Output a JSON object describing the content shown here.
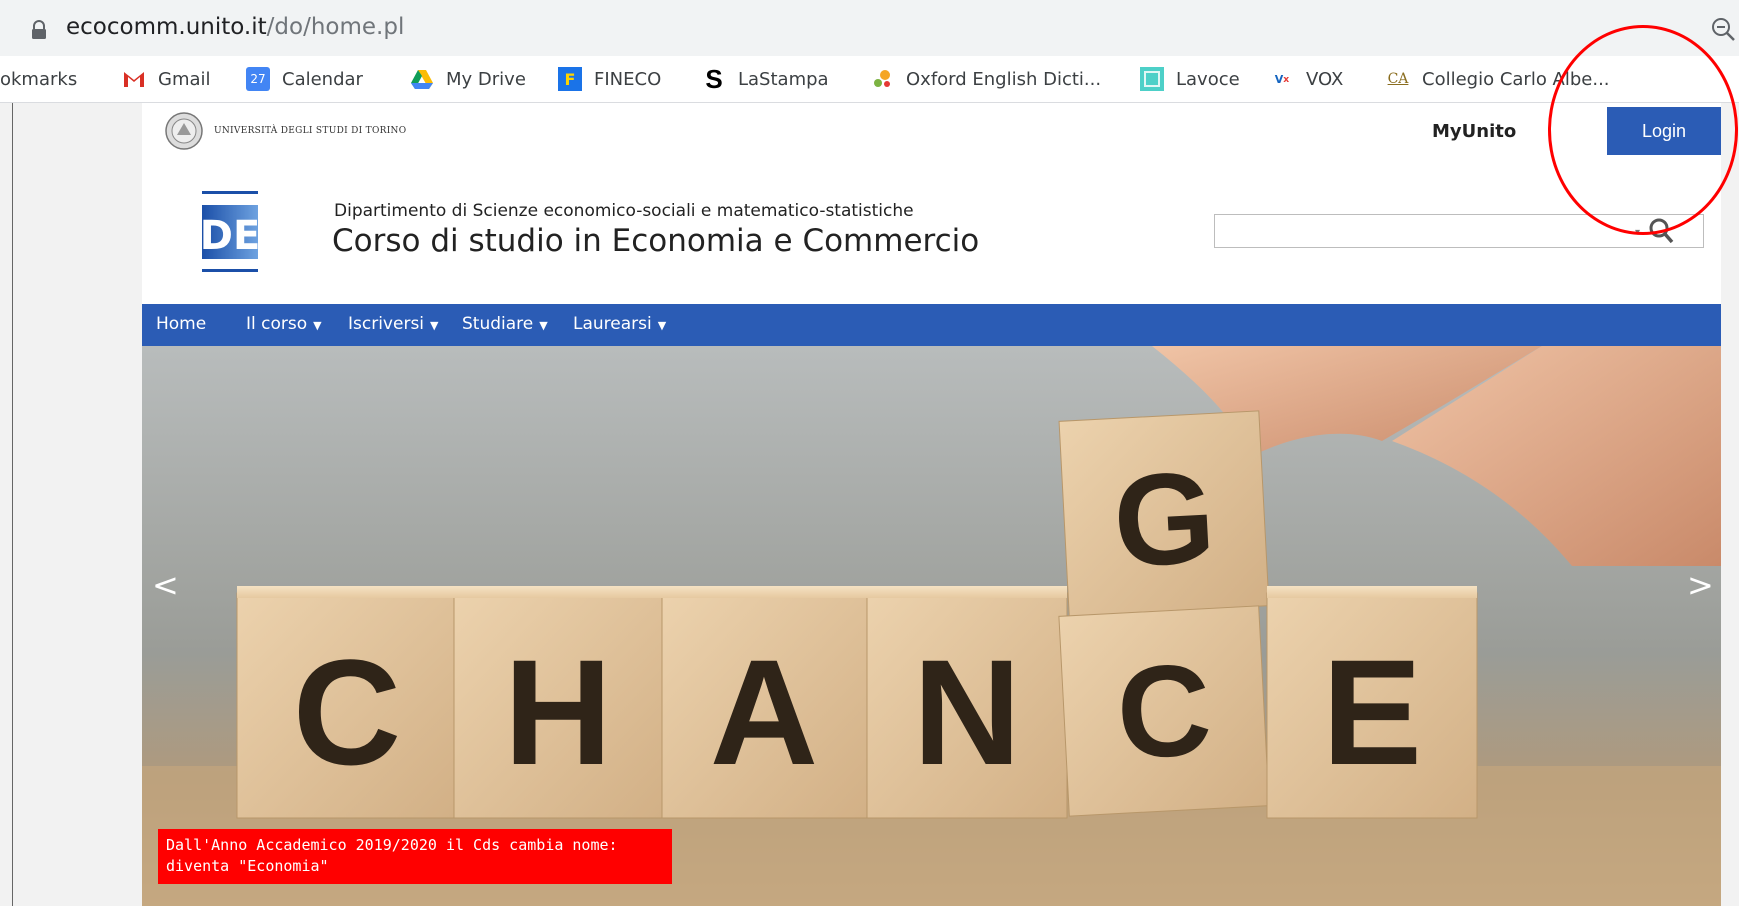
{
  "browser": {
    "url_host": "ecocomm.unito.it",
    "url_path": "/do/home.pl",
    "bookmarks": [
      {
        "label": "okmarks",
        "icon": "none"
      },
      {
        "label": "Gmail",
        "icon": "gmail-icon"
      },
      {
        "label": "Calendar",
        "icon": "calendar-icon",
        "badge": "27"
      },
      {
        "label": "My Drive",
        "icon": "drive-icon"
      },
      {
        "label": "FINECO",
        "icon": "fineco-icon",
        "badge": "F"
      },
      {
        "label": "LaStampa",
        "icon": "lastampa-icon",
        "badge": "S"
      },
      {
        "label": "Oxford English Dicti...",
        "icon": "oxford-icon"
      },
      {
        "label": "Lavoce",
        "icon": "lavoce-icon"
      },
      {
        "label": "VOX",
        "icon": "vox-icon"
      },
      {
        "label": "Collegio Carlo Albe...",
        "icon": "collegio-icon",
        "badge": "CA"
      }
    ]
  },
  "site": {
    "university_name": "UNIVERSITÀ DEGLI STUDI DI TORINO",
    "myunito": "MyUnito",
    "login": "Login",
    "logo_text": "DE",
    "department": "Dipartimento di Scienze economico-sociali e matematico-statistiche",
    "course_title": "Corso di studio in Economia e Commercio",
    "nav": [
      {
        "label": "Home",
        "dropdown": false
      },
      {
        "label": "Il corso",
        "dropdown": true
      },
      {
        "label": "Iscriversi",
        "dropdown": true
      },
      {
        "label": "Studiare",
        "dropdown": true
      },
      {
        "label": "Laurearsi",
        "dropdown": true
      }
    ],
    "hero": {
      "blocks": [
        "C",
        "H",
        "A",
        "N",
        "G",
        "C",
        "E"
      ],
      "prev": "<",
      "next": ">",
      "caption_line1": "Dall'Anno Accademico 2019/2020 il Cds cambia nome:",
      "caption_line2": "diventa \"Economia\""
    }
  },
  "colors": {
    "nav_blue": "#2b5cb5",
    "caption_red": "#ff0000",
    "annotation_red": "#ff0000"
  }
}
